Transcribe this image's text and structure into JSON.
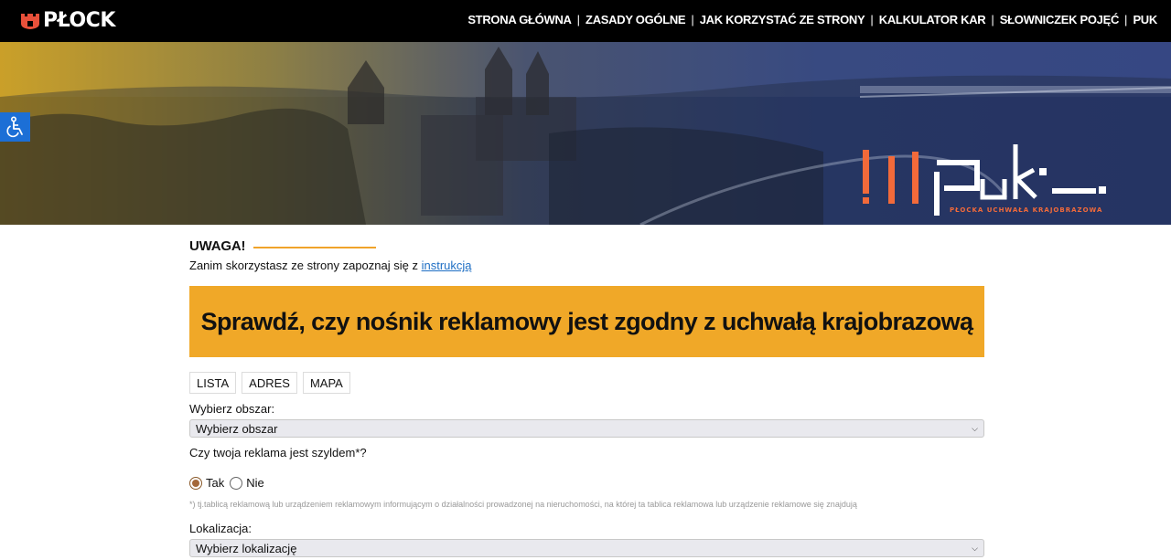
{
  "header": {
    "logo_text": "PŁOCK",
    "nav": [
      {
        "label": "STRONA GŁÓWNA"
      },
      {
        "label": "ZASADY OGÓLNE"
      },
      {
        "label": "JAK KORZYSTAĆ ZE STRONY"
      },
      {
        "label": "KALKULATOR KAR"
      },
      {
        "label": "SŁOWNICZEK POJĘĆ"
      },
      {
        "label": "PUK"
      }
    ]
  },
  "hero": {
    "brand_wordmark": "PUK",
    "brand_tagline": "PŁOCKA UCHWAŁA KRAJOBRAZOWA",
    "accent": "#f26a3a"
  },
  "notice": {
    "title": "UWAGA!",
    "text_before_link": "Zanim skorzystasz ze strony zapoznaj się z ",
    "link_text": "instrukcją"
  },
  "banner": {
    "title": "Sprawdź, czy nośnik reklamowy jest zgodny z uchwałą krajobrazową",
    "color": "#f0a828"
  },
  "tabs": [
    {
      "label": "LISTA"
    },
    {
      "label": "ADRES"
    },
    {
      "label": "MAPA"
    }
  ],
  "form": {
    "area_label": "Wybierz obszar:",
    "area_value": "Wybierz obszar",
    "sign_question": "Czy twoja reklama jest szyldem*?",
    "yes_label": "Tak",
    "no_label": "Nie",
    "selected": "Tak",
    "footnote": "*) tj.tablicą reklamową lub urządzeniem reklamowym informującym o działalności prowadzonej na nieruchomości, na której ta tablica reklamowa lub urządzenie reklamowe się znajdują",
    "location_label": "Lokalizacja:",
    "location_value": "Wybierz lokalizację"
  },
  "accessibility": {
    "icon": "wheelchair-icon"
  }
}
